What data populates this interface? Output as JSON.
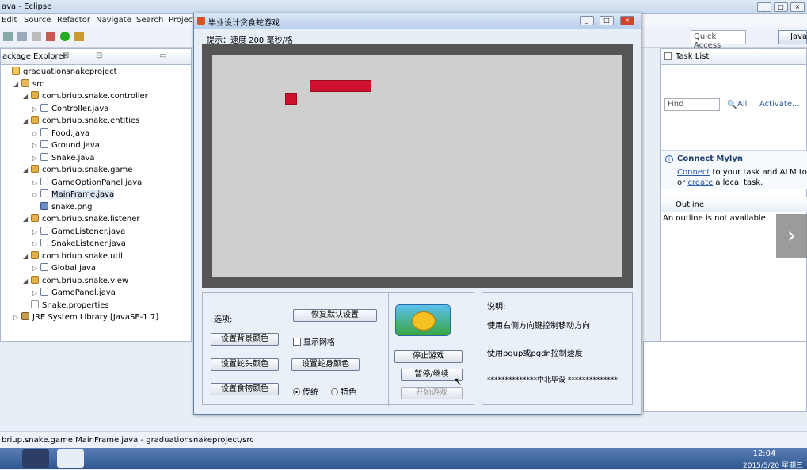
{
  "eclipse": {
    "title": "ava - Eclipse",
    "menu": [
      "Edit",
      "Source",
      "Refactor",
      "Navigate",
      "Search",
      "Project"
    ],
    "quick_access": "Quick Access",
    "perspective": "Java",
    "status": "briup.snake.game.MainFrame.java - graduationsnakeproject/src"
  },
  "package_explorer": {
    "tab": "ackage Explorer",
    "items": [
      {
        "text": "graduationsnakeproject",
        "indent": 0,
        "icon": "project-icon"
      },
      {
        "text": "src",
        "indent": 1,
        "icon": "src-folder-icon"
      },
      {
        "text": "com.briup.snake.controller",
        "indent": 2,
        "icon": "package-icon"
      },
      {
        "text": "Controller.java",
        "indent": 3,
        "icon": "java-file-icon"
      },
      {
        "text": "com.briup.snake.entities",
        "indent": 2,
        "icon": "package-icon"
      },
      {
        "text": "Food.java",
        "indent": 3,
        "icon": "java-file-icon"
      },
      {
        "text": "Ground.java",
        "indent": 3,
        "icon": "java-file-icon"
      },
      {
        "text": "Snake.java",
        "indent": 3,
        "icon": "java-file-icon"
      },
      {
        "text": "com.briup.snake.game",
        "indent": 2,
        "icon": "package-icon"
      },
      {
        "text": "GameOptionPanel.java",
        "indent": 3,
        "icon": "java-file-icon"
      },
      {
        "text": "MainFrame.java",
        "indent": 3,
        "icon": "java-file-icon"
      },
      {
        "text": "snake.png",
        "indent": 3,
        "icon": "image-file-icon"
      },
      {
        "text": "com.briup.snake.listener",
        "indent": 2,
        "icon": "package-icon"
      },
      {
        "text": "GameListener.java",
        "indent": 3,
        "icon": "java-file-icon"
      },
      {
        "text": "SnakeListener.java",
        "indent": 3,
        "icon": "java-file-icon"
      },
      {
        "text": "com.briup.snake.util",
        "indent": 2,
        "icon": "package-icon"
      },
      {
        "text": "Global.java",
        "indent": 3,
        "icon": "java-file-icon"
      },
      {
        "text": "com.briup.snake.view",
        "indent": 2,
        "icon": "package-icon"
      },
      {
        "text": "GamePanel.java",
        "indent": 3,
        "icon": "java-file-icon"
      },
      {
        "text": "Snake.properties",
        "indent": 2,
        "icon": "properties-file-icon"
      },
      {
        "text": "JRE System Library [JavaSE-1.7]",
        "indent": 1,
        "icon": "library-icon"
      }
    ]
  },
  "task_list": {
    "tab": "Task List",
    "find_placeholder": "Find",
    "all": "All",
    "activate": "Activate..."
  },
  "mylyn": {
    "title": "Connect Mylyn",
    "line1_link": "Connect",
    "line1_rest": " to your task and ALM tools",
    "line2_pre": "or ",
    "line2_link": "create",
    "line2_rest": " a local task."
  },
  "outline": {
    "tab": "Outline",
    "empty": "An outline is not available."
  },
  "game": {
    "title": "毕业设计贪食蛇游戏",
    "hint": "提示：速度 200 毫秒/格",
    "options_label": "选项:",
    "restore_defaults": "恢复默认设置",
    "set_bg_color": "设置背景颜色",
    "show_grid": "显示网格",
    "set_head_color": "设置蛇头颜色",
    "set_body_color": "设置蛇身颜色",
    "set_food_color": "设置食物颜色",
    "radio_traditional": "传统",
    "radio_special": "特色",
    "stop_game": "停止游戏",
    "pause_resume": "暂停/继续",
    "start_game": "开始游戏",
    "desc_title": "说明:",
    "desc_line1": "使用右侧方向键控制移动方向",
    "desc_line2": "使用pgup或pgdn控制速度",
    "desc_line3": "**************中北毕设 **************",
    "snake_color": "#d0102f",
    "board_bg": "#cfcfcf",
    "border_color": "#555555"
  },
  "clock": {
    "time": "12:04",
    "date": "2015/5/20 星期三"
  }
}
